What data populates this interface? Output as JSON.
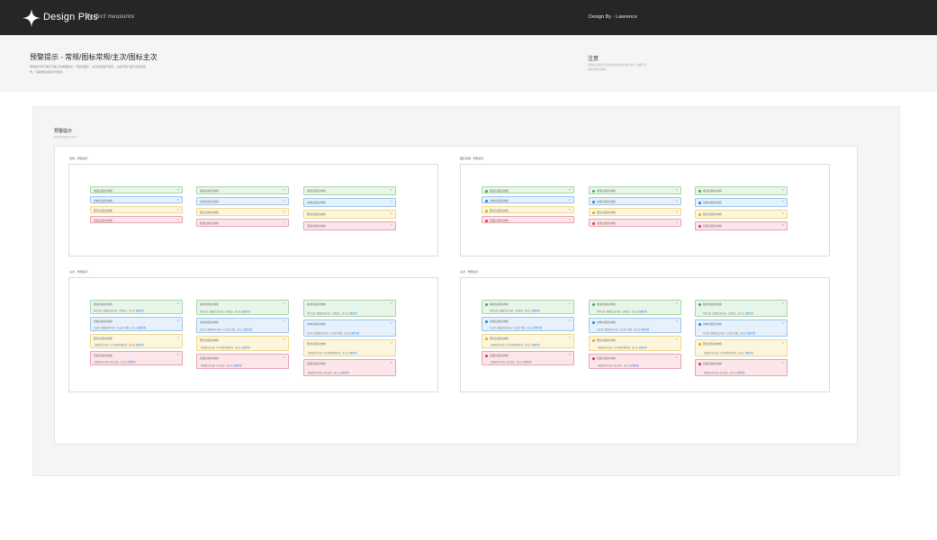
{
  "brand": {
    "name": "Design Plus",
    "signature": "Perfect measures"
  },
  "designer": "Design By · Lawrence",
  "page": {
    "title": "预警提示 - 常规/图标常规/主次/图标主次",
    "description": "预警提示用于展示页面上的重要信息，可结合图标、主次标题进行使用，以提示用户进行对应的操作。当需要持续展示时使用。"
  },
  "notice": {
    "title": "注意",
    "text": "预警提示需配合背景颜色和边框颜色进行使用，根据不同状态选择不同颜色。"
  },
  "section": {
    "title": "预警提示",
    "subtitle": "预警提示的规范与样式"
  },
  "groups": [
    {
      "label": "常规 - 预警提示"
    },
    {
      "label": "图标常规 - 预警提示"
    },
    {
      "label": "主次 - 预警提示"
    },
    {
      "label": "主次 - 预警提示"
    }
  ],
  "alert": {
    "close": "×",
    "link": "查看详情",
    "titles": {
      "success": "成功信息提示内容",
      "info": "文本信息提示内容",
      "warning": "警告信息提示内容",
      "error": "错误信息提示内容"
    },
    "descs": {
      "success": "你提交的【数据信息内容】已经成功，请点击",
      "info": "在这里【数据信息内容】可以进行查看，请点击",
      "warning": "【数据信息内容】存在问题需要处理，请点击",
      "error": "【数据信息内容】提交失败，请点击"
    }
  },
  "colors": {
    "success": "#3daa4b",
    "info": "#2b7fd8",
    "warning": "#e5a713",
    "error": "#d9334d"
  }
}
